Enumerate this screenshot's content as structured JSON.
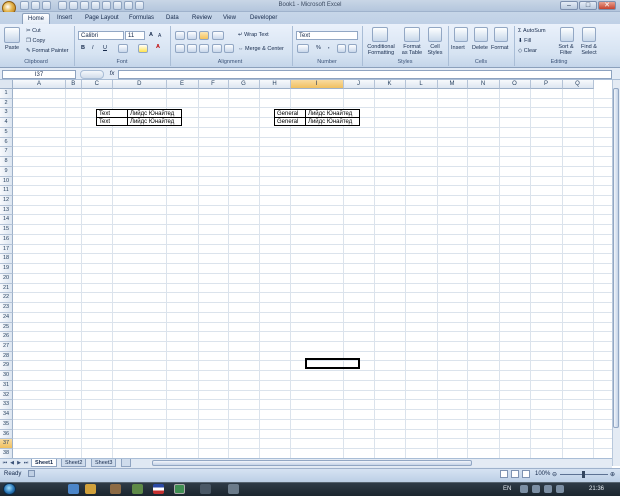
{
  "window": {
    "title": "Book1 - Microsoft Excel",
    "minimize": "–",
    "maximize": "□",
    "close": "✕"
  },
  "ribbon_tabs": [
    "Home",
    "Insert",
    "Page Layout",
    "Formulas",
    "Data",
    "Review",
    "View",
    "Developer"
  ],
  "clipboard": {
    "paste": "Paste",
    "cut": "Cut",
    "copy": "Copy",
    "format_painter": "Format Painter",
    "label": "Clipboard"
  },
  "font": {
    "name": "Calibri",
    "size": "11",
    "bold": "B",
    "italic": "I",
    "underline": "U",
    "grow": "A",
    "shrink": "A",
    "color_letter": "A",
    "label": "Font"
  },
  "alignment": {
    "wrap": "Wrap Text",
    "merge": "Merge & Center",
    "label": "Alignment"
  },
  "number": {
    "format": "Text",
    "percent": "%",
    "comma": ",",
    "label": "Number"
  },
  "styles": {
    "conditional": [
      "Conditional",
      "Formatting"
    ],
    "format_table": [
      "Format",
      "as Table"
    ],
    "cell_styles": [
      "Cell",
      "Styles"
    ],
    "label": "Styles"
  },
  "cells": {
    "insert": "Insert",
    "delete": "Delete",
    "format": "Format",
    "label": "Cells"
  },
  "editing": {
    "autosum": "AutoSum",
    "fill": "Fill",
    "clear": "Clear",
    "sort": [
      "Sort &",
      "Filter"
    ],
    "find": [
      "Find &",
      "Select"
    ],
    "label": "Editing"
  },
  "formula_bar": {
    "name_box": "I37",
    "fx": "fx",
    "value": ""
  },
  "columns": [
    "A",
    "B",
    "C",
    "D",
    "E",
    "F",
    "G",
    "H",
    "I",
    "J",
    "K",
    "L",
    "M",
    "N",
    "O",
    "P",
    "Q"
  ],
  "rows": [
    "1",
    "2",
    "3",
    "4",
    "5",
    "6",
    "7",
    "8",
    "9",
    "10",
    "11",
    "12",
    "13",
    "14",
    "15",
    "16",
    "17",
    "18",
    "19",
    "20",
    "21",
    "22",
    "23",
    "24",
    "25",
    "26",
    "27",
    "28",
    "29",
    "30",
    "31",
    "32",
    "33",
    "34",
    "35",
    "36",
    "37",
    "38"
  ],
  "cells_data": {
    "C3": "Text",
    "D3": "Лийдс Юнайтед",
    "C4": "Text",
    "D4": "Лийдс Юнайтед",
    "H3": "General",
    "I3": "Лийдс Юнайтед",
    "H4": "General",
    "I4": "Лийдс Юнайтед"
  },
  "selected_cell": "I37",
  "sheets": [
    "Sheet1",
    "Sheet2",
    "Sheet3"
  ],
  "active_sheet": "Sheet1",
  "status": {
    "ready": "Ready",
    "zoom": "100%"
  },
  "taskbar": {
    "lang": "EN",
    "clock": "21:36"
  }
}
